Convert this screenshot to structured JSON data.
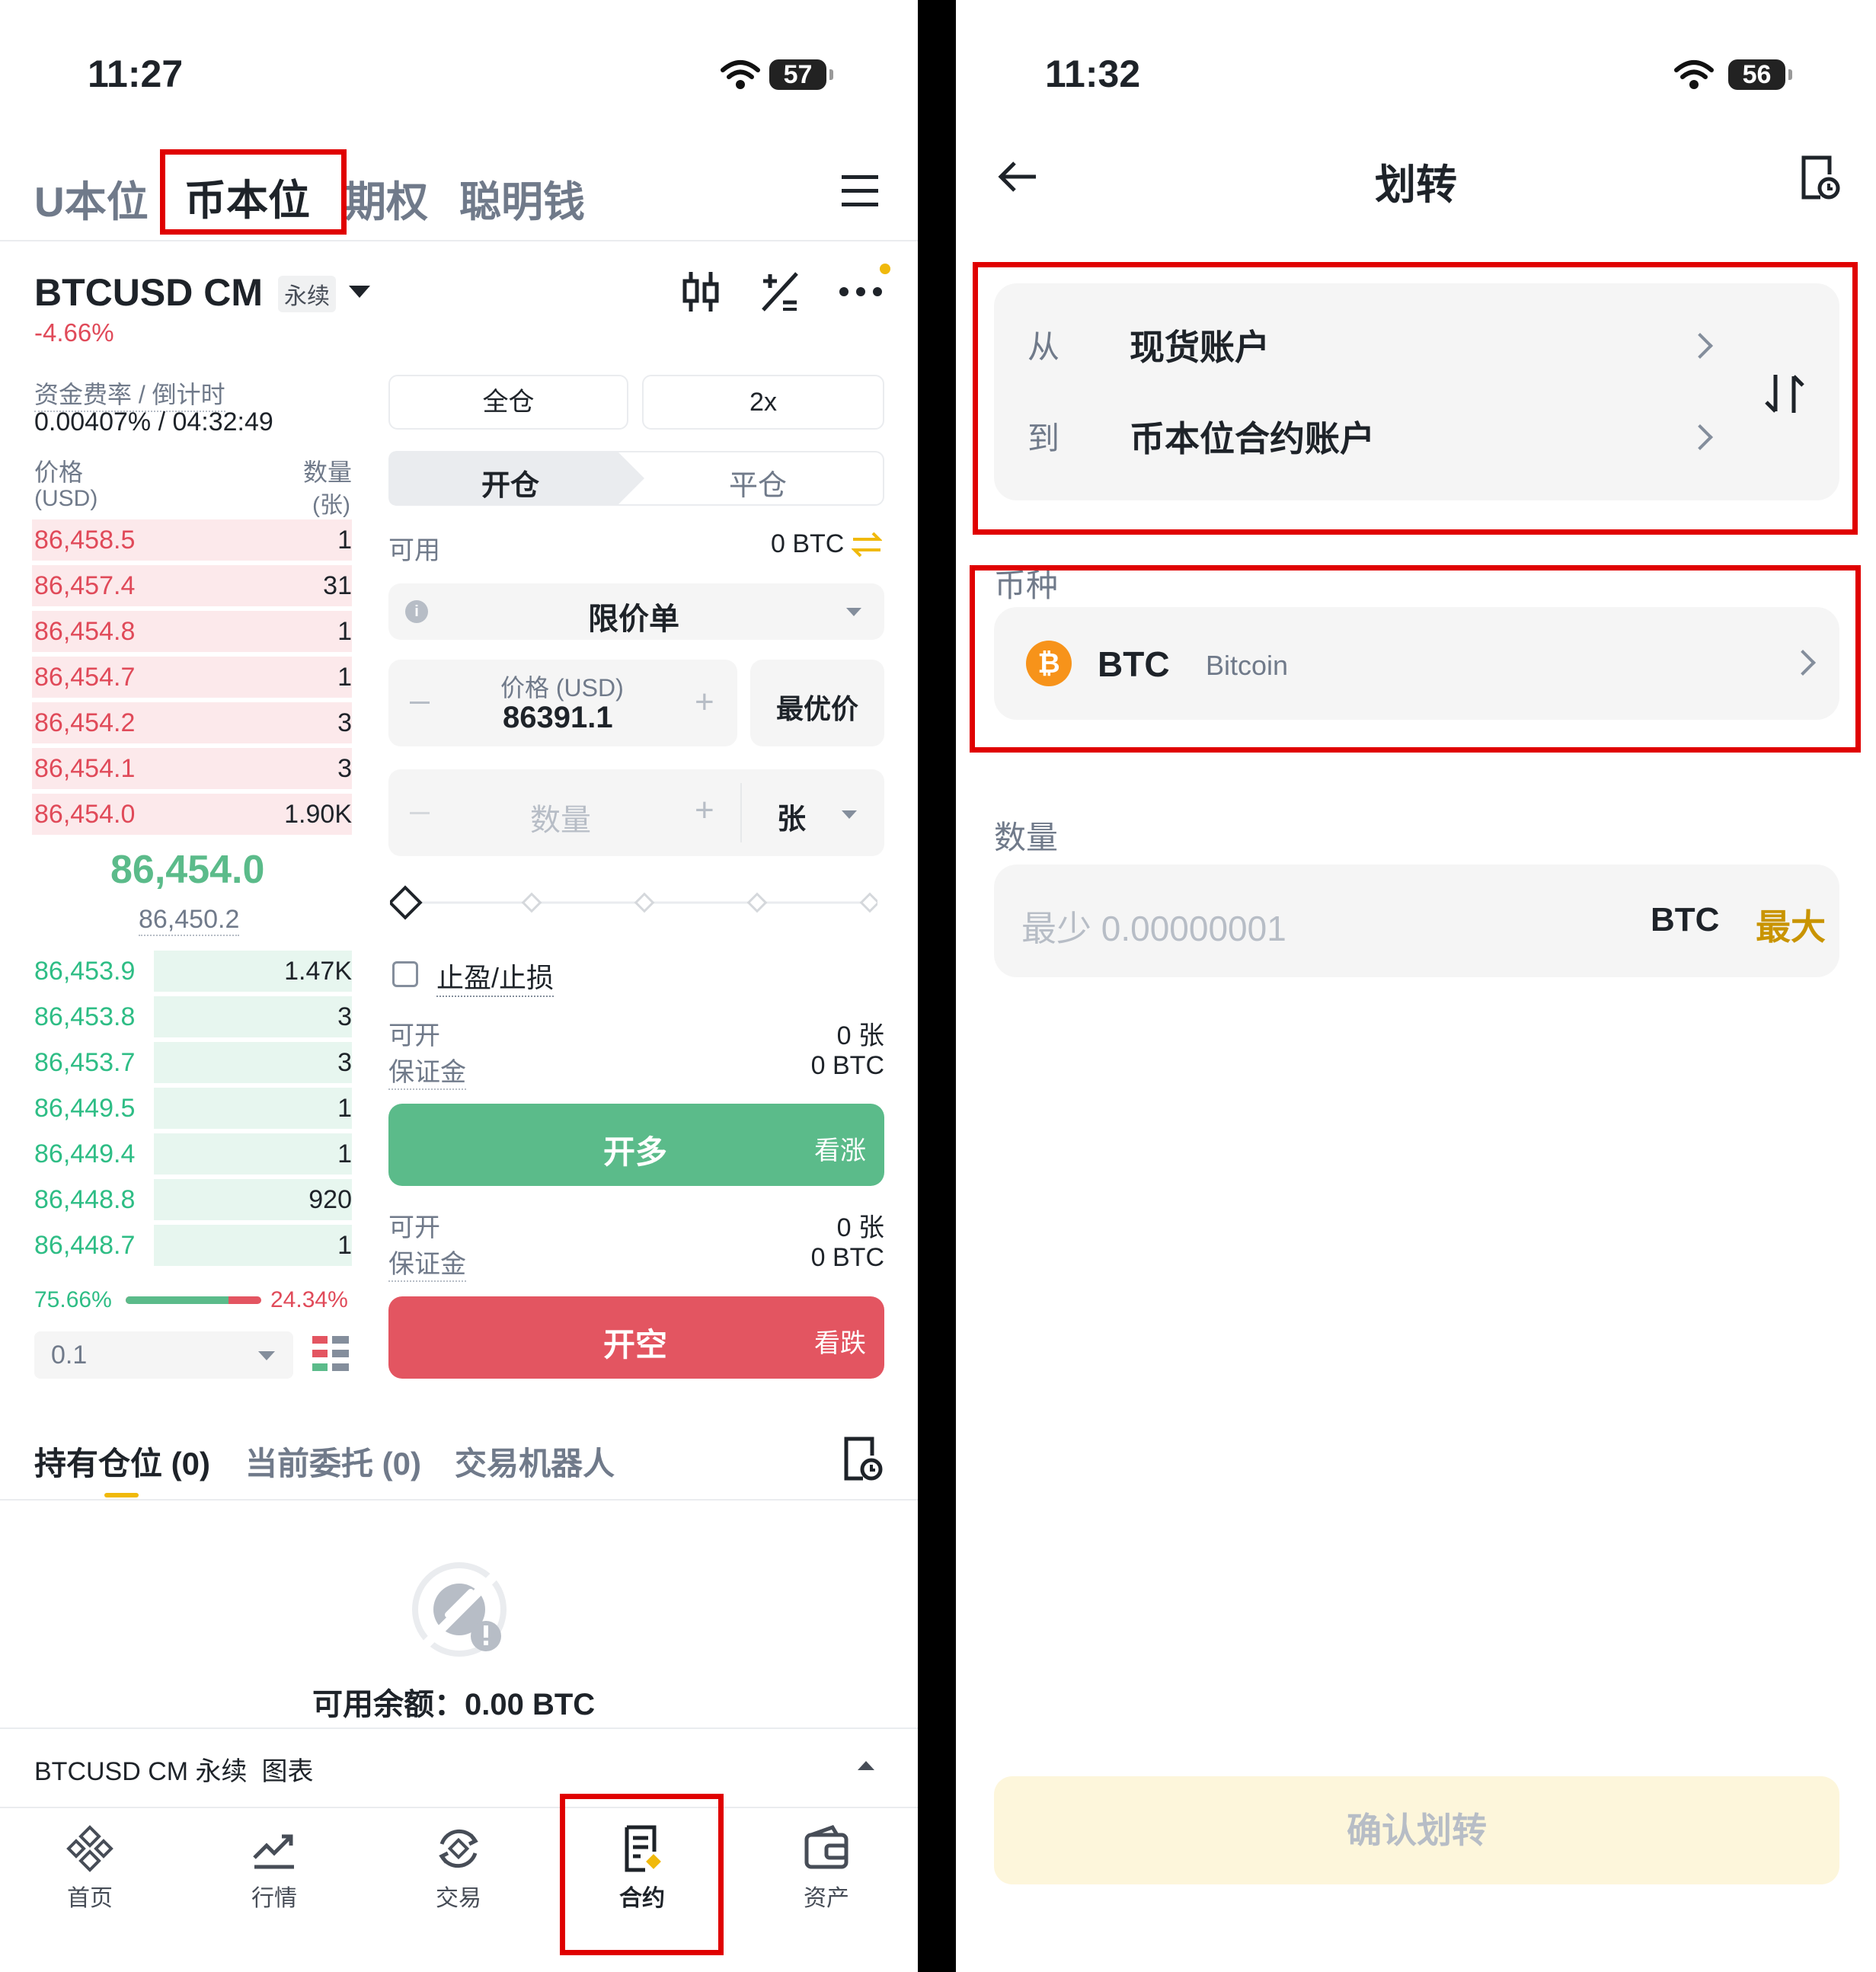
{
  "left": {
    "status": {
      "time": "11:27",
      "battery": "57"
    },
    "tabs": [
      "U本位",
      "币本位",
      "期权",
      "聪明钱"
    ],
    "symbol": {
      "name": "BTCUSD CM",
      "badge": "永续",
      "change": "-4.66%"
    },
    "funding": {
      "label": "资金费率 / 倒计时",
      "value": "0.00407% / 04:32:49"
    },
    "orderbook": {
      "price_header": "价格",
      "price_unit": "(USD)",
      "qty_header": "数量",
      "qty_unit": "(张)",
      "asks": [
        {
          "price": "86,458.5",
          "qty": "1"
        },
        {
          "price": "86,457.4",
          "qty": "31"
        },
        {
          "price": "86,454.8",
          "qty": "1"
        },
        {
          "price": "86,454.7",
          "qty": "1"
        },
        {
          "price": "86,454.2",
          "qty": "3"
        },
        {
          "price": "86,454.1",
          "qty": "3"
        },
        {
          "price": "86,454.0",
          "qty": "1.90K"
        }
      ],
      "last_price": "86,454.0",
      "mark_price": "86,450.2",
      "bids": [
        {
          "price": "86,453.9",
          "qty": "1.47K"
        },
        {
          "price": "86,453.8",
          "qty": "3"
        },
        {
          "price": "86,453.7",
          "qty": "3"
        },
        {
          "price": "86,449.5",
          "qty": "1"
        },
        {
          "price": "86,449.4",
          "qty": "1"
        },
        {
          "price": "86,448.8",
          "qty": "920"
        },
        {
          "price": "86,448.7",
          "qty": "1"
        }
      ],
      "buy_ratio": "75.66%",
      "sell_ratio": "24.34%",
      "buy_ratio_value": 0.7566,
      "precision": "0.1"
    },
    "order": {
      "margin_mode": "全仓",
      "leverage": "2x",
      "open_tab": "开仓",
      "close_tab": "平仓",
      "available_label": "可用",
      "available_value": "0 BTC",
      "order_type": "限价单",
      "price_label": "价格 (USD)",
      "price_value": "86391.1",
      "best_price": "最优价",
      "qty_placeholder": "数量",
      "qty_unit": "张",
      "tpsl": "止盈/止损",
      "long": {
        "can_open_label": "可开",
        "can_open_value": "0 张",
        "margin_label": "保证金",
        "margin_value": "0 BTC",
        "button": "开多",
        "hint": "看涨"
      },
      "short": {
        "can_open_label": "可开",
        "can_open_value": "0 张",
        "margin_label": "保证金",
        "margin_value": "0 BTC",
        "button": "开空",
        "hint": "看跌"
      }
    },
    "positions": {
      "tabs": [
        "持有仓位 (0)",
        "当前委托 (0)",
        "交易机器人"
      ],
      "empty_text": "可用余额：0.00 BTC"
    },
    "chart_bar": {
      "label": "BTCUSD CM 永续  图表"
    },
    "bottom_nav": [
      "首页",
      "行情",
      "交易",
      "合约",
      "资产"
    ]
  },
  "right": {
    "status": {
      "time": "11:32",
      "battery": "56"
    },
    "title": "划转",
    "from_label": "从",
    "from_value": "现货账户",
    "to_label": "到",
    "to_value": "币本位合约账户",
    "coin_section": "币种",
    "coin_symbol": "BTC",
    "coin_name": "Bitcoin",
    "amount_section": "数量",
    "amount_placeholder": "最少 0.00000001",
    "amount_unit": "BTC",
    "max_label": "最大",
    "confirm": "确认划转",
    "colors": {
      "accent": "#c99400",
      "confirm_bg": "#fdf6db",
      "confirm_text": "#b7bdc6"
    }
  }
}
